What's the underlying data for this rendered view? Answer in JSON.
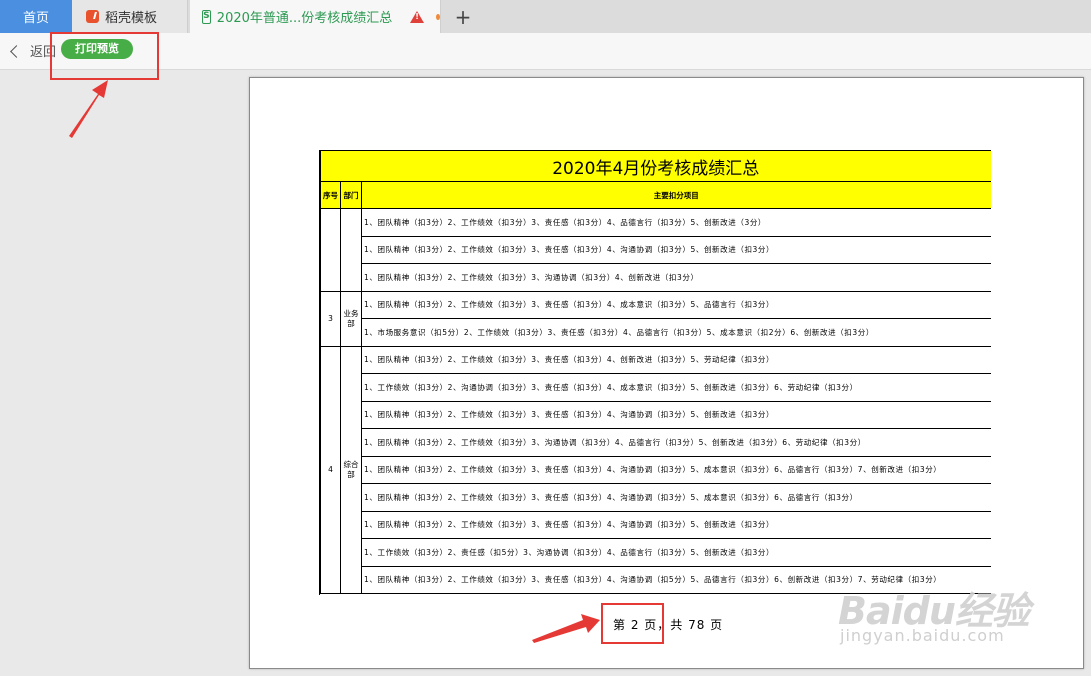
{
  "tabs": {
    "home": "首页",
    "docer": "稻壳模板",
    "active": "2020年普通...份考核成绩汇总",
    "add": "+"
  },
  "toolbar": {
    "back_label": "返回",
    "print_preview": "打印预览"
  },
  "sheet": {
    "title": "2020年4月份考核成绩汇总",
    "headers": {
      "seq": "序号",
      "dept": "部门",
      "items": "主要扣分项目"
    },
    "groups": [
      {
        "seq": "",
        "dept": "",
        "rows": [
          "1、团队精神（扣3分）2、工作绩效（扣3分）3、责任感（扣3分）4、品德言行（扣3分）5、创新改进（3分）",
          "1、团队精神（扣3分）2、工作绩效（扣3分）3、责任感（扣3分）4、沟通协调（扣3分）5、创新改进（扣3分）",
          "1、团队精神（扣3分）2、工作绩效（扣3分）3、沟通协调（扣3分）4、创新改进（扣3分）"
        ]
      },
      {
        "seq": "3",
        "dept": "业务部",
        "rows": [
          "1、团队精神（扣3分）2、工作绩效（扣3分）3、责任感（扣3分）4、成本意识（扣3分）5、品德言行（扣3分）",
          "1、市场服务意识（扣5分）2、工作绩效（扣3分）3、责任感（扣3分）4、品德言行（扣3分）5、成本意识（扣2分）6、创新改进（扣3分）"
        ]
      },
      {
        "seq": "4",
        "dept": "综合部",
        "rows": [
          "1、团队精神（扣3分）2、工作绩效（扣3分）3、责任感（扣3分）4、创新改进（扣3分）5、劳动纪律（扣3分）",
          "1、工作绩效（扣3分）2、沟通协调（扣3分）3、责任感（扣3分）4、成本意识（扣3分）5、创新改进（扣3分）6、劳动纪律（扣3分）",
          "1、团队精神（扣3分）2、工作绩效（扣3分）3、责任感（扣3分）4、沟通协调（扣3分）5、创新改进（扣3分）",
          "1、团队精神（扣3分）2、工作绩效（扣3分）3、沟通协调（扣3分）4、品德言行（扣3分）5、创新改进（扣3分）6、劳动纪律（扣3分）",
          "1、团队精神（扣3分）2、工作绩效（扣3分）3、责任感（扣3分）4、沟通协调（扣3分）5、成本意识（扣3分）6、品德言行（扣3分）7、创新改进（扣3分）",
          "1、团队精神（扣3分）2、工作绩效（扣3分）3、责任感（扣3分）4、沟通协调（扣3分）5、成本意识（扣3分）6、品德言行（扣3分）",
          "1、团队精神（扣3分）2、工作绩效（扣3分）3、责任感（扣3分）4、沟通协调（扣3分）5、创新改进（扣3分）",
          "1、工作绩效（扣3分）2、责任感（扣5分）3、沟通协调（扣3分）4、品德言行（扣3分）5、创新改进（扣3分）",
          "1、团队精神（扣3分）2、工作绩效（扣3分）3、责任感（扣3分）4、沟通协调（扣5分）5、品德言行（扣3分）6、创新改进（扣3分）7、劳动纪律（扣3分）"
        ]
      }
    ]
  },
  "footer": {
    "page_info": "第 2 页，共 78 页"
  },
  "watermark": {
    "brand": "Baidu经验",
    "url": "jingyan.baidu.com"
  },
  "colors": {
    "highlight": "#e53935",
    "accent_green": "#47ad47",
    "header_yellow": "#ffff00",
    "home_tab_blue": "#4a8fe0"
  }
}
